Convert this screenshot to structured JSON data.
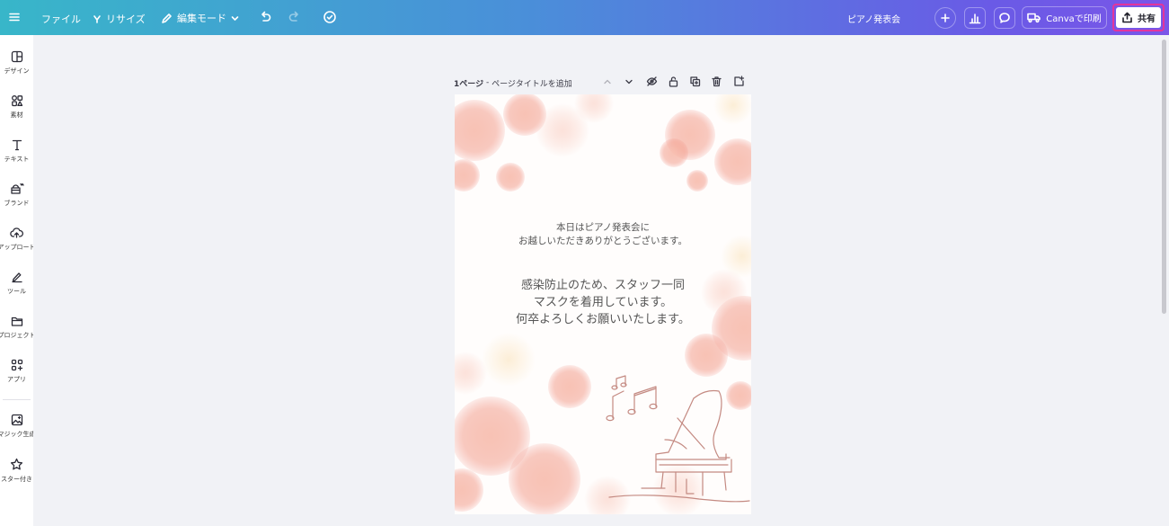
{
  "topbar": {
    "menu_icon": "hamburger-icon",
    "file_label": "ファイル",
    "resize_label": "リサイズ",
    "edit_mode_label": "編集モード",
    "undo_icon": "undo-icon",
    "redo_icon": "redo-icon",
    "save_status_icon": "cloud-check-icon",
    "doc_title": "ピアノ発表会",
    "print_label": "Canvaで印刷",
    "share_label": "共有",
    "colors": {
      "gradient_start": "#38b6c9",
      "gradient_end": "#7a56e8",
      "share_highlight": "#e3359b"
    }
  },
  "sidebar": {
    "items": [
      {
        "label": "デザイン",
        "icon": "layout-icon"
      },
      {
        "label": "素材",
        "icon": "elements-icon"
      },
      {
        "label": "テキスト",
        "icon": "text-icon"
      },
      {
        "label": "ブランド",
        "icon": "brand-icon"
      },
      {
        "label": "アップロード",
        "icon": "upload-cloud-icon"
      },
      {
        "label": "ツール",
        "icon": "draw-tool-icon"
      },
      {
        "label": "プロジェクト",
        "icon": "folder-icon"
      },
      {
        "label": "アプリ",
        "icon": "apps-icon"
      },
      {
        "label": "マジック生成",
        "icon": "magic-image-icon"
      },
      {
        "label": "スター付き",
        "icon": "star-icon"
      }
    ]
  },
  "page": {
    "number_label": "1ページ",
    "separator": " - ",
    "title_placeholder": "ページタイトルを追加"
  },
  "canvas": {
    "message1": [
      "本日はピアノ発表会に",
      "お越しいただきありがとうございます。"
    ],
    "message2": [
      "感染防止のため、スタッフ一同",
      "マスクを着用しています。",
      "何卒よろしくお願いいたします。"
    ]
  }
}
